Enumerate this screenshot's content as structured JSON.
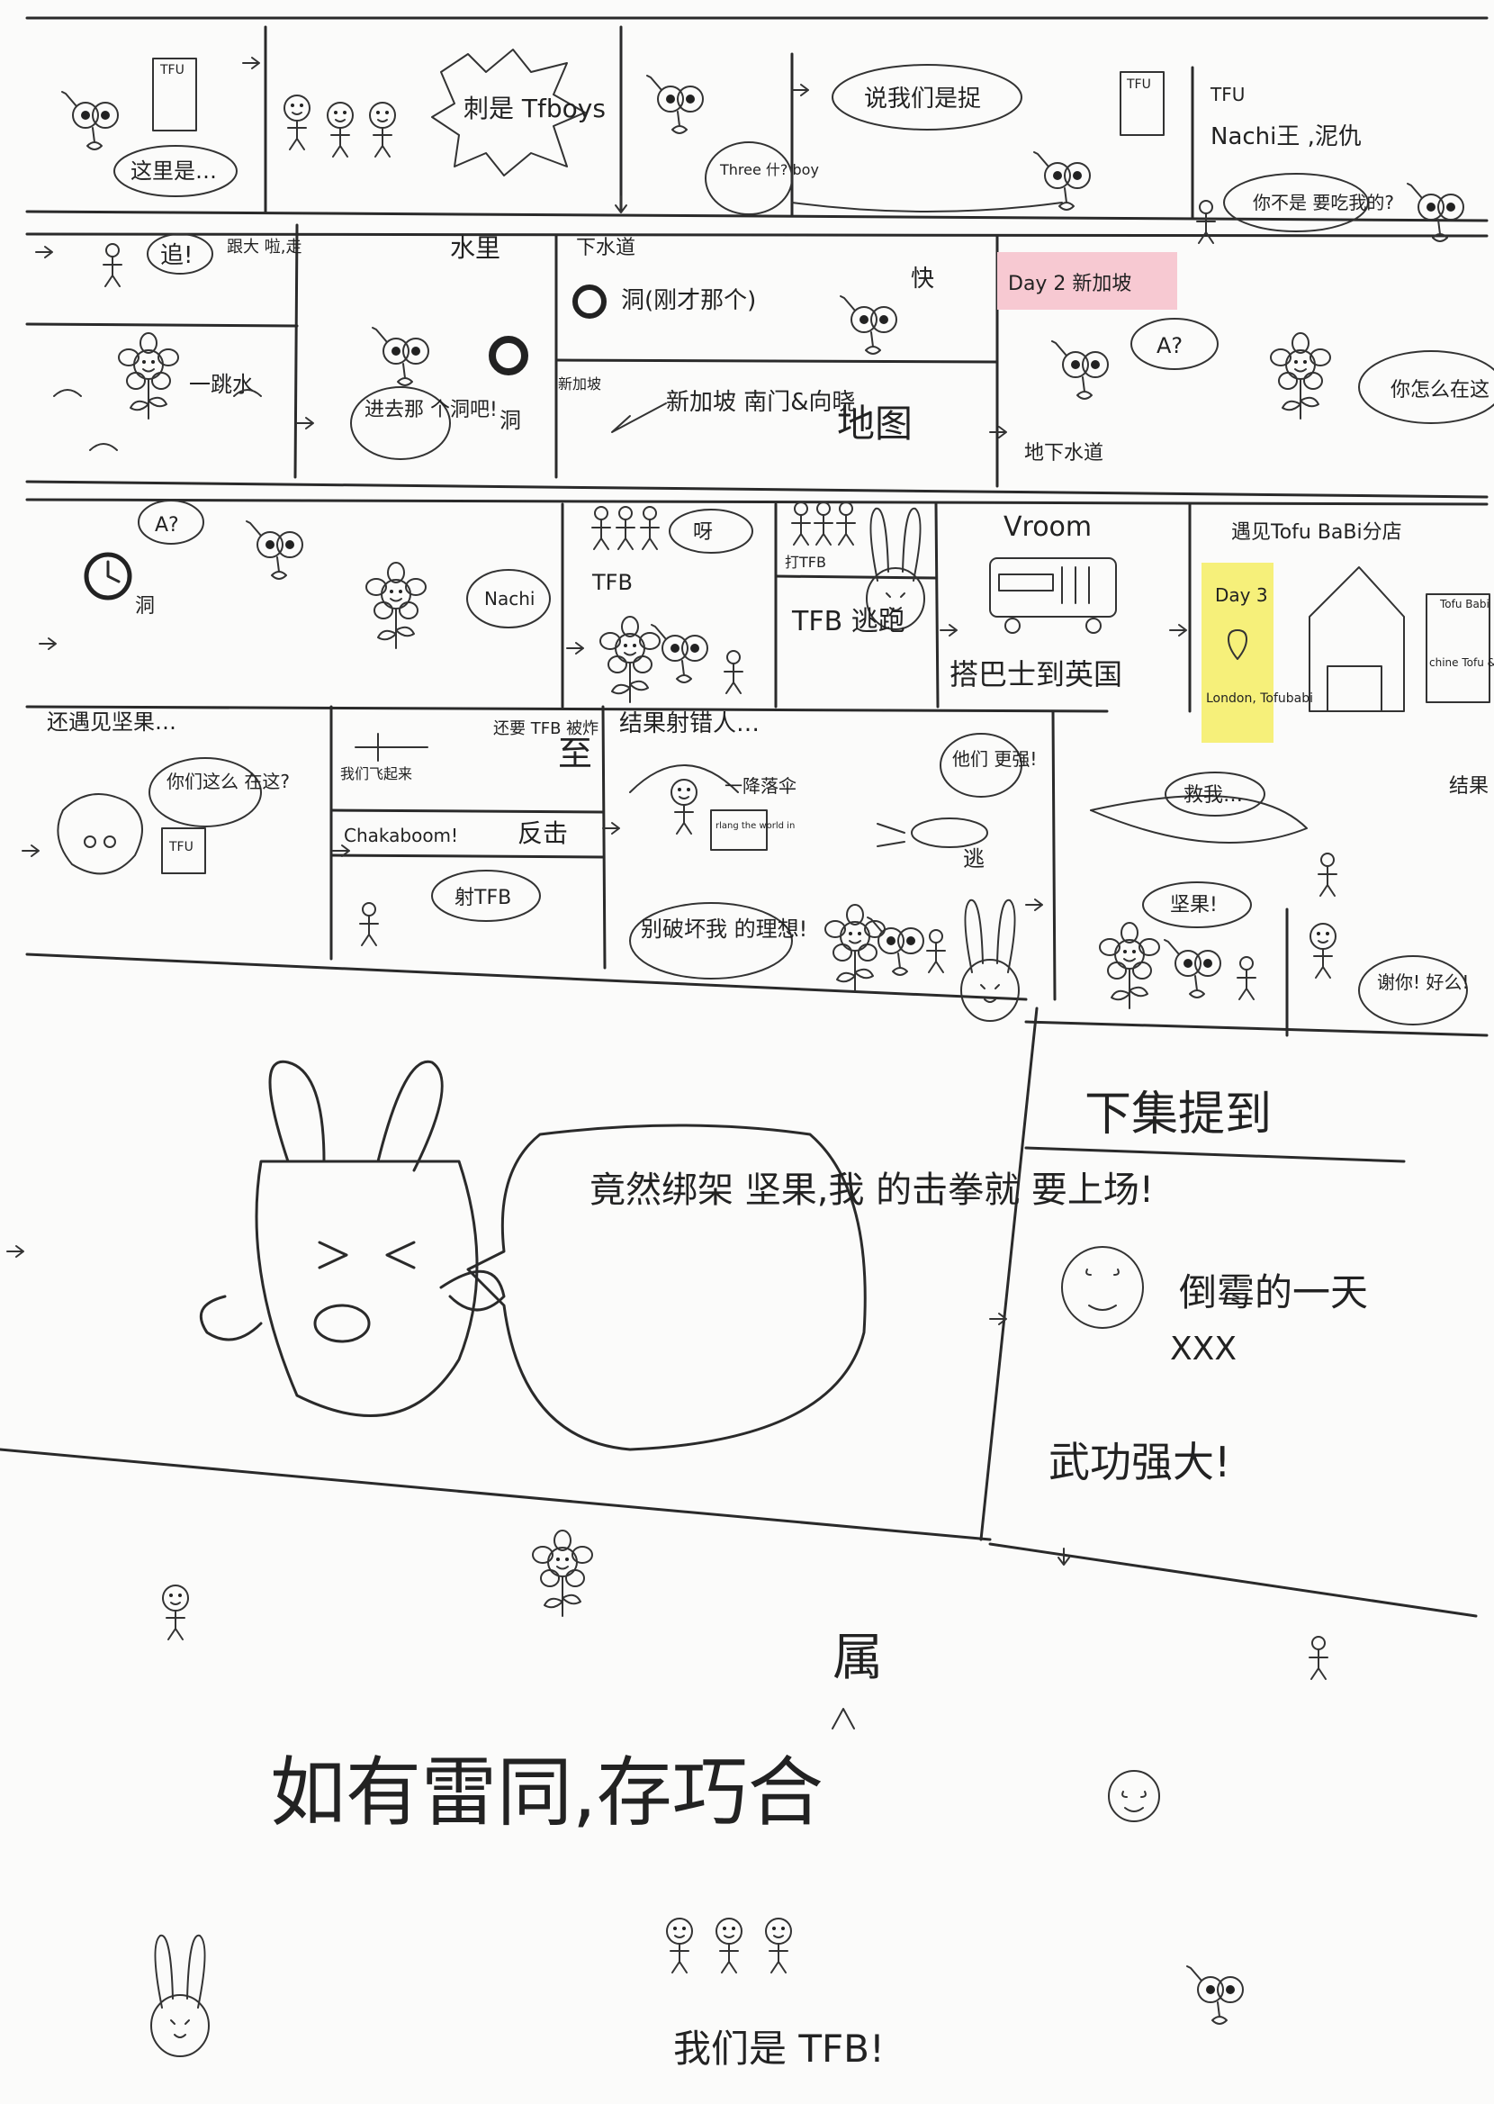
{
  "colors": {
    "paper": "#fbfbfa",
    "ink": "#2a2a2a",
    "sticky_pink": "#f7c9d2",
    "sticky_yellow": "#f6f07a"
  },
  "row1": {
    "p1_bubble": "这里是…",
    "p1_sign": "TFU",
    "p2_burst": "刺是 Tfboys",
    "p3_bubble": "Three 什? boy",
    "p4_bubble": "说我们是捉",
    "p4_sign": "TFU",
    "p5_title": "TFU",
    "p5_names": "Nachi王 ,泥仇",
    "p5_bubble": "你不是 要吃我的?"
  },
  "row2": {
    "chase_bubble": "追!",
    "chase_side": "跟大 啦,走",
    "jump_label": "一跳水",
    "water_label": "水里",
    "water_bubble": "进去那 个洞吧!",
    "hole_label": "洞",
    "sewer_title": "下水道",
    "sewer_hole": "洞(刚才那个)",
    "sewer_fast": "快",
    "map_text": "新加坡 南门&向晓",
    "map_label": "地图",
    "map_corner": "新加坡",
    "day2_note": "Day 2 新加坡",
    "day2_bubble": "A?",
    "day2_place": "地下水道",
    "day2_flower_bubble": "你怎么在这"
  },
  "row3": {
    "clock_bubble": "A?",
    "clock_label": "洞",
    "flower_bubble": "Nachi",
    "tfb_label": "TFB",
    "tfb_bubble": "呀",
    "fight_label": "打TFB",
    "tfb_run": "TFB 逃跑",
    "vroom": "Vroom",
    "bus_caption": "搭巴士到英国",
    "tofu_title": "遇见Tofu BaBi分店",
    "day3_note": "Day 3",
    "day3_place": "London, Tofubabi",
    "tofu_shop": "Tofu Babi",
    "tofu_sign": "chine Tofu & Pork"
  },
  "row4": {
    "nut_title": "还遇见坚果…",
    "nut_bubble": "你们这么 在这?",
    "nut_sign": "TFU",
    "fly_label": "我们飞起来",
    "explode_label": "还要 TFB 被炸",
    "explode_big": "至",
    "chakaboom": "Chakaboom!",
    "counter": "反击",
    "shoot_bubble": "射TFB",
    "wrong_title": "结果射错人…",
    "parachute": "一降落伞",
    "small_bubble": "rlang the world in",
    "dream_bubble": "别破坏我 的理想!",
    "strong_bubble": "他们 更强!",
    "flee": "逃",
    "save_bubble": "救我…",
    "nut_call": "坚果!",
    "thanks_bubble": "谢你! 好么!",
    "side_text": "结果 坚果 被抓 走"
  },
  "big": {
    "rabbit_bubble": "竟然绑架 坚果,我 的击拳就 要上场!",
    "preview_title": "下集提到",
    "preview_line": "倒霉的一天",
    "preview_xxx": "XXX",
    "preview_power": "武功强大!"
  },
  "footer": {
    "disclaimer": "如有雷同,存巧合",
    "insert": "属",
    "signoff": "我们是 TFB!"
  }
}
